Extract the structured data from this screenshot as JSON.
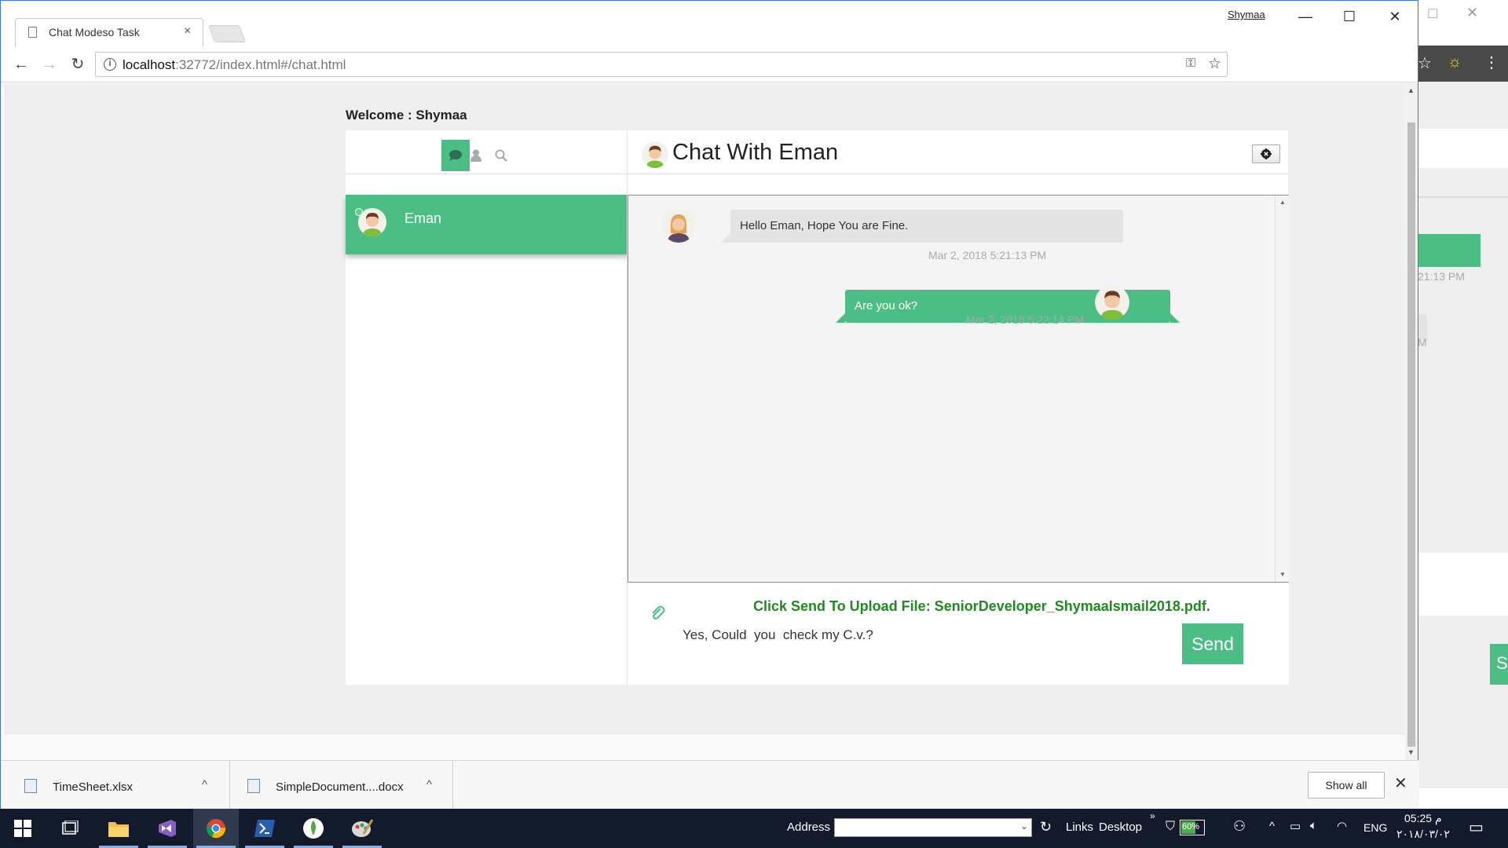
{
  "browser": {
    "tab_title": "Chat Modeso Task",
    "window_user": "Shymaa",
    "url_host": "localhost",
    "url_path": ":32772/index.html#/chat.html"
  },
  "page": {
    "welcome": "Welcome : Shymaa",
    "contact_name": "Eman",
    "chat_title": "Chat With Eman",
    "messages": [
      {
        "text": "Hello Eman, Hope You are Fine.",
        "time": "Mar 2, 2018 5:21:13 PM",
        "direction": "incoming"
      },
      {
        "text": "Are you ok?",
        "time": "Mar 2, 2018 5:22:14 PM",
        "direction": "outgoing"
      }
    ],
    "upload_notice": "Click Send To Upload File: SeniorDeveloper_ShymaaIsmail2018.pdf.",
    "input_value": "Yes, Could  you  check my C.v.?",
    "send_label": "Send",
    "accent_color": "#4dbd86"
  },
  "background_window": {
    "time_fragment": "21:13 PM",
    "fragment_m": "M",
    "send_fragment": "S"
  },
  "downloads": {
    "items": [
      "TimeSheet.xlsx",
      "SimpleDocument....docx"
    ],
    "show_all": "Show all"
  },
  "taskbar": {
    "address_label": "Address",
    "links": "Links",
    "desktop": "Desktop",
    "battery": "60%",
    "lang": "ENG",
    "time": "05:25 م",
    "date": "٢٠١٨/٠٣/٠٢"
  }
}
